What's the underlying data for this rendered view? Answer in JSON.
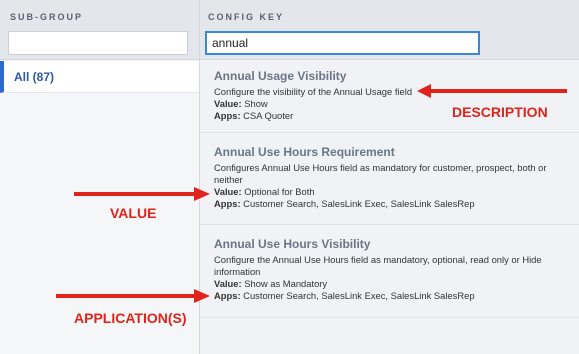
{
  "columns": {
    "subgroup_label": "SUB-GROUP",
    "config_key_label": "CONFIG KEY"
  },
  "inputs": {
    "subgroup_value": "",
    "config_key_value": "annual"
  },
  "sidebar": {
    "items": [
      {
        "label": "All (87)",
        "selected": true
      }
    ]
  },
  "results": [
    {
      "title": "Annual Usage Visibility",
      "description": "Configure the visibility of the Annual Usage field",
      "value_label": "Value:",
      "value": "Show",
      "apps_label": "Apps:",
      "apps": "CSA Quoter"
    },
    {
      "title": "Annual Use Hours Requirement",
      "description_line1": "Configures Annual Use Hours field as mandatory for customer, prospect, both or",
      "description_line2": "neither",
      "value_label": "Value:",
      "value": "Optional for Both",
      "apps_label": "Apps:",
      "apps": "Customer Search, SalesLink Exec, SalesLink SalesRep"
    },
    {
      "title": "Annual Use Hours Visibility",
      "description_line1": "Configure the Annual Use Hours field as mandatory, optional, read only or Hide",
      "description_line2": "information",
      "value_label": "Value:",
      "value": "Show as Mandatory",
      "apps_label": "Apps:",
      "apps": "Customer Search, SalesLink Exec, SalesLink SalesRep"
    }
  ],
  "annotations": {
    "description": "DESCRIPTION",
    "value": "VALUE",
    "applications": "APPLICATION(S)",
    "color": "#e0231b"
  },
  "colors": {
    "accent": "#3c87de",
    "selected_border": "#2a6ad1",
    "title_text": "#6a7587"
  }
}
